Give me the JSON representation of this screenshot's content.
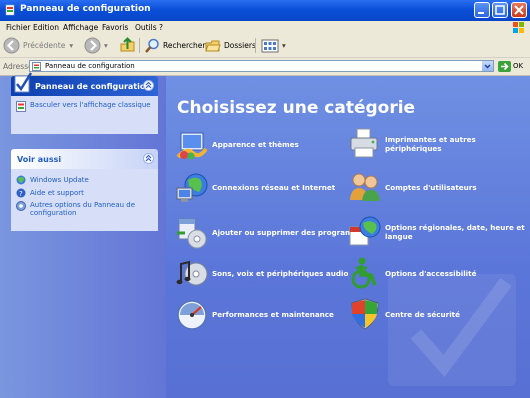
{
  "window": {
    "title": "Panneau de configuration"
  },
  "menu": [
    "Fichier",
    "Edition",
    "Affichage",
    "Favoris",
    "Outils",
    "?"
  ],
  "toolbar": {
    "back_label": "Précédente",
    "search_label": "Rechercher",
    "folders_label": "Dossiers"
  },
  "address": {
    "label": "Adresse",
    "value": "Panneau de configuration",
    "go_label": "OK"
  },
  "sidebar": {
    "control_panel": {
      "title": "Panneau de configuration",
      "link": "Basculer vers l'affichage classique"
    },
    "see_also": {
      "title": "Voir aussi",
      "links": [
        "Windows Update",
        "Aide et support",
        "Autres options du Panneau de configuration"
      ]
    }
  },
  "main": {
    "title": "Choisissez une catégorie",
    "categories": [
      {
        "label": "Apparence et thèmes",
        "icon": "appearance-icon"
      },
      {
        "label": "Imprimantes et autres périphériques",
        "icon": "printer-icon"
      },
      {
        "label": "Connexions réseau et Internet",
        "icon": "network-icon"
      },
      {
        "label": "Comptes d'utilisateurs",
        "icon": "users-icon"
      },
      {
        "label": "Ajouter ou supprimer des programmes",
        "icon": "add-remove-icon"
      },
      {
        "label": "Options régionales, date, heure et langue",
        "icon": "regional-icon"
      },
      {
        "label": "Sons, voix et périphériques audio",
        "icon": "sound-icon"
      },
      {
        "label": "Options d'accessibilité",
        "icon": "accessibility-icon"
      },
      {
        "label": "Performances et maintenance",
        "icon": "performance-icon"
      },
      {
        "label": "Centre de sécurité",
        "icon": "security-shield-icon"
      }
    ]
  },
  "colors": {
    "title_bar": "#0a4fd8",
    "sidebar_bg": "#7a96df",
    "main_bg": "#6f90e3",
    "link": "#215dc6"
  }
}
